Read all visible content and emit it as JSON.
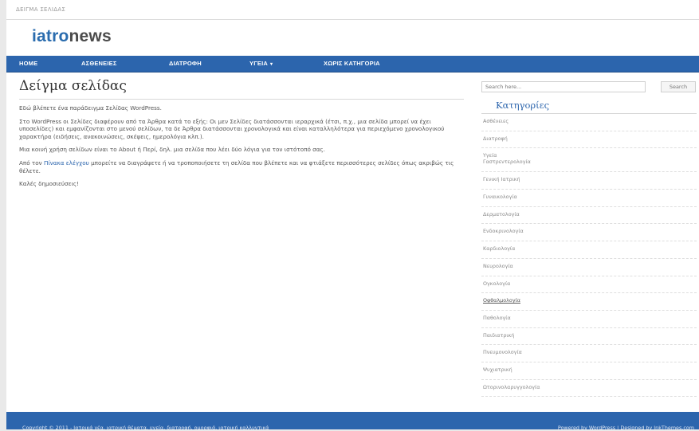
{
  "breadcrumb": "ΔΕΙΓΜΑ ΣΕΛΙΔΑΣ",
  "logo": {
    "part1": "iatro",
    "part2": "news"
  },
  "nav": [
    {
      "label": "HOME"
    },
    {
      "label": "ΑΣΘΕΝΕΙΕΣ"
    },
    {
      "label": "ΔΙΑΤΡΟΦΗ"
    },
    {
      "label": "ΥΓΕΙΑ",
      "caret": "▾"
    },
    {
      "label": "ΧΩΡΙΣ ΚΑΤΗΓΟΡΙΑ"
    }
  ],
  "page": {
    "title": "Δείγμα σελίδας",
    "paragraphs": [
      "Εδώ βλέπετε ένα παράδειγμα Σελίδας WordPress.",
      "Στο WordPress οι Σελίδες διαφέρουν από τα Άρθρα κατά το εξής: Οι μεν Σελίδες διατάσσονται ιεραρχικά (έτσι, π.χ., μια σελίδα μπορεί να έχει υποσελίδες) και εμφανίζονται στο μενού σελίδων, τα δε Άρθρα διατάσσονται χρονολογικά και είναι καταλληλότερα για περιεχόμενο χρονολογικού χαρακτήρα (ειδήσεις, ανακοινώσεις, σκέψεις, ημερολόγια κλπ.).",
      "Μια κοινή χρήση σελίδων είναι το About ή Περί, δηλ. μια σελίδα που λέει δύο λόγια για τον ιστότοπό σας.",
      "Καλές δημοσιεύσεις!"
    ],
    "para4": {
      "before": "Από τον ",
      "link": "Πίνακα ελέγχου",
      "after": " μπορείτε να διαγράψετε ή να τροποποιήσετε τη σελίδα που βλέπετε και να φτιάξετε περισσότερες σελίδες όπως ακριβώς τις θέλετε."
    }
  },
  "sidebar": {
    "search_placeholder": "Search here...",
    "search_button": "Search",
    "categories_title": "Κατηγορίες",
    "categories": [
      "Ασθένειες",
      "Διατροφή",
      "Υγεία",
      "Γαστρεντερολογία",
      "Γενική Ιατρική",
      "Γυναικολογία",
      "Δερματολογία",
      "Ενδοκρινολογία",
      "Καρδιολογία",
      "Νευρολογία",
      "Ογκολογία",
      "Οφθαλμολογία",
      "Παθολογία",
      "Παιδιατρική",
      "Πνευμονολογία",
      "Ψυχιατρική",
      "Ωτορινολαρυγγολογία"
    ]
  },
  "footer": {
    "left": "Copyright © 2011 - Ιατρικά νέα, ιατρική θέματα, υγεία, διατροφή, ομορφιά, ιατρική καλλυντικά",
    "right": "Powered by WordPress | Designed by InkThemes.com"
  }
}
